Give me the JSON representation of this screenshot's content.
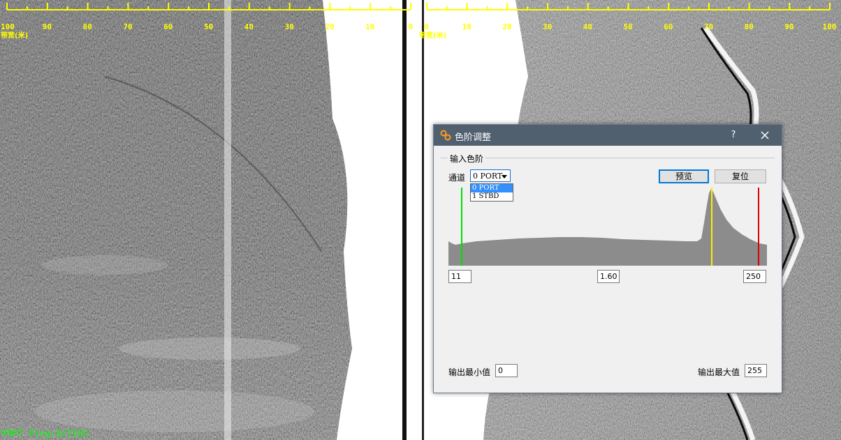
{
  "port_ruler": {
    "labels": [
      "100",
      "90",
      "80",
      "70",
      "60",
      "50",
      "40",
      "30",
      "20",
      "10",
      "0"
    ],
    "title": "带宽(米)"
  },
  "stbd_ruler": {
    "labels": [
      "0",
      "10",
      "20",
      "30",
      "40",
      "50",
      "60",
      "70",
      "80",
      "90",
      "100"
    ],
    "title": "带宽(米)"
  },
  "status": {
    "ping_text": "PORT Ping:0/2101"
  },
  "dialog": {
    "title": "色阶调整",
    "help": "?",
    "group_title": "输入色阶",
    "channel_label": "通道",
    "channel_selected": "0 PORT",
    "channel_options": [
      "0 PORT",
      "1 STBD"
    ],
    "preview_label": "预览",
    "reset_label": "复位",
    "input_min": "11",
    "input_gamma": "1.60",
    "input_max": "250",
    "output_min_label": "输出最小值",
    "output_min": "0",
    "output_max_label": "输出最大值",
    "output_max": "255"
  },
  "colors": {
    "ruler": "#ffff00",
    "status": "#00ff00",
    "titlebar": "#51606f",
    "histogram_fill": "#8c8c8c",
    "min_marker": "#00dd00",
    "gamma_marker": "#ffee00",
    "max_marker": "#dd0000"
  },
  "icons": [
    "levels-icon",
    "help-icon",
    "close-icon",
    "dropdown-arrow-icon"
  ]
}
